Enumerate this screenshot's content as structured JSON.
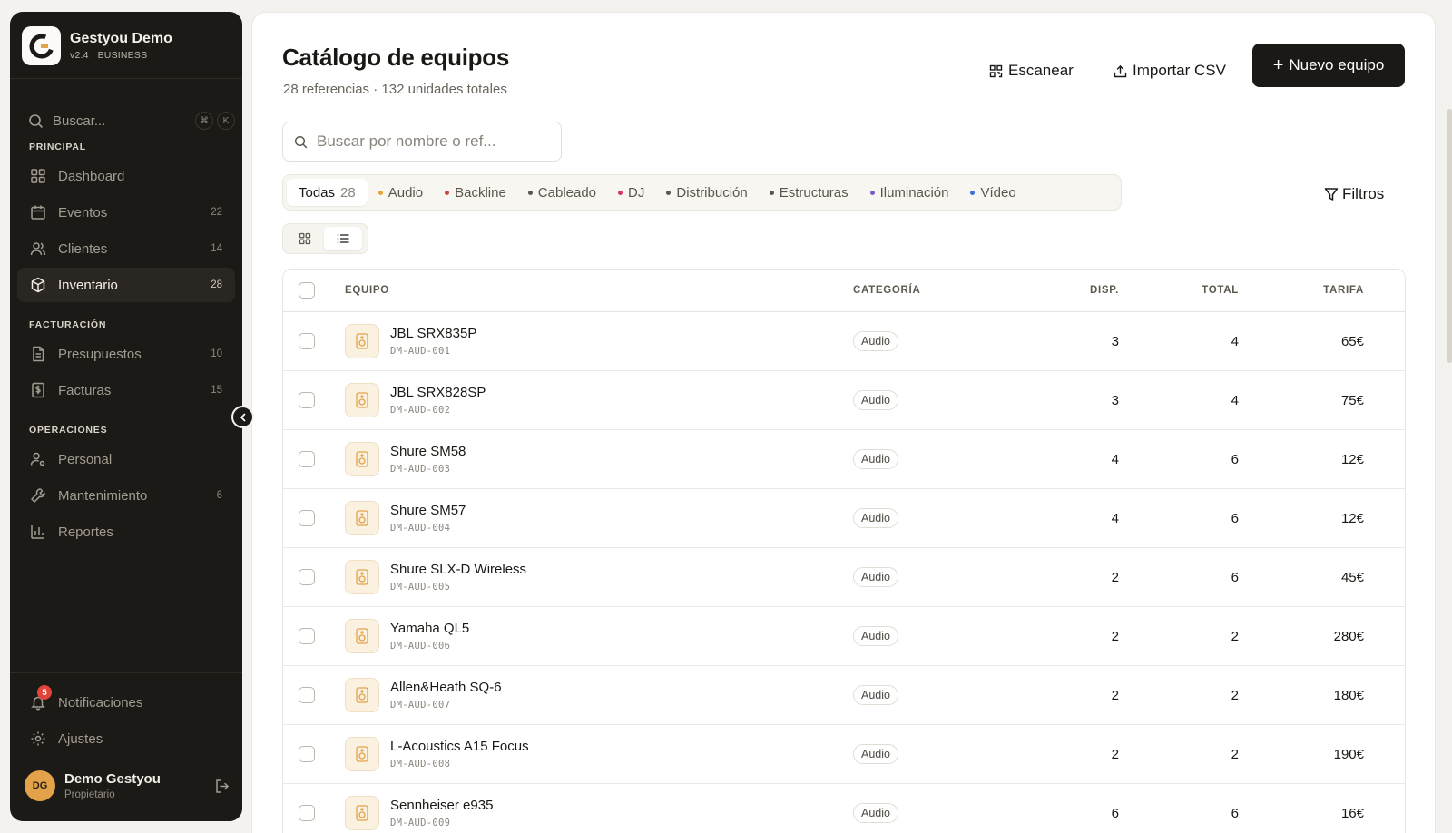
{
  "app": {
    "name": "Gestyou Demo",
    "version": "v2.4 · BUSINESS"
  },
  "sidebar": {
    "search": {
      "label": "Buscar...",
      "kbd1": "⌘",
      "kbd2": "K"
    },
    "sections": {
      "principal": "PRINCIPAL",
      "facturacion": "FACTURACIÓN",
      "operaciones": "OPERACIONES"
    },
    "items": [
      {
        "label": "Dashboard",
        "count": "",
        "icon": "grid-icon"
      },
      {
        "label": "Eventos",
        "count": "22",
        "icon": "calendar-icon"
      },
      {
        "label": "Clientes",
        "count": "14",
        "icon": "users-icon"
      },
      {
        "label": "Inventario",
        "count": "28",
        "icon": "box-icon",
        "active": true
      },
      {
        "label": "Presupuestos",
        "count": "10",
        "icon": "document-icon"
      },
      {
        "label": "Facturas",
        "count": "15",
        "icon": "invoice-icon"
      },
      {
        "label": "Personal",
        "count": "",
        "icon": "user-settings-icon"
      },
      {
        "label": "Mantenimiento",
        "count": "6",
        "icon": "wrench-icon"
      },
      {
        "label": "Reportes",
        "count": "",
        "icon": "bar-chart-icon"
      }
    ],
    "bottom": {
      "notifications": "Notificaciones",
      "notifications_badge": "5",
      "settings": "Ajustes"
    },
    "user": {
      "initials": "DG",
      "name": "Demo Gestyou",
      "role": "Propietario"
    }
  },
  "header": {
    "title": "Catálogo de equipos",
    "subtitle": "28 referencias · 132 unidades totales",
    "scan_label": "Escanear",
    "import_label": "Importar CSV",
    "new_label": "Nuevo equipo"
  },
  "search": {
    "placeholder": "Buscar por nombre o ref..."
  },
  "categories": [
    {
      "label": "Todas",
      "count": "28",
      "active": true
    },
    {
      "label": "Audio",
      "color": "#e8a23a"
    },
    {
      "label": "Backline",
      "color": "#c8493a"
    },
    {
      "label": "Cableado",
      "color": "#5a554d"
    },
    {
      "label": "DJ",
      "color": "#d6336c"
    },
    {
      "label": "Distribución",
      "color": "#5a554d"
    },
    {
      "label": "Estructuras",
      "color": "#5a554d"
    },
    {
      "label": "Iluminación",
      "color": "#7c5cc4"
    },
    {
      "label": "Vídeo",
      "color": "#3a6fd8"
    }
  ],
  "filters_label": "Filtros",
  "view_modes": [
    "grid-view-icon",
    "list-view-icon"
  ],
  "table": {
    "columns": {
      "equipo": "EQUIPO",
      "categoria": "CATEGORÍA",
      "disp": "DISP.",
      "total": "TOTAL",
      "tarifa": "TARIFA"
    },
    "rows": [
      {
        "name": "JBL SRX835P",
        "ref": "DM-AUD-001",
        "category": "Audio",
        "disp": "3",
        "total": "4",
        "rate": "65€"
      },
      {
        "name": "JBL SRX828SP",
        "ref": "DM-AUD-002",
        "category": "Audio",
        "disp": "3",
        "total": "4",
        "rate": "75€"
      },
      {
        "name": "Shure SM58",
        "ref": "DM-AUD-003",
        "category": "Audio",
        "disp": "4",
        "total": "6",
        "rate": "12€"
      },
      {
        "name": "Shure SM57",
        "ref": "DM-AUD-004",
        "category": "Audio",
        "disp": "4",
        "total": "6",
        "rate": "12€"
      },
      {
        "name": "Shure SLX-D Wireless",
        "ref": "DM-AUD-005",
        "category": "Audio",
        "disp": "2",
        "total": "6",
        "rate": "45€"
      },
      {
        "name": "Yamaha QL5",
        "ref": "DM-AUD-006",
        "category": "Audio",
        "disp": "2",
        "total": "2",
        "rate": "280€"
      },
      {
        "name": "Allen&Heath SQ-6",
        "ref": "DM-AUD-007",
        "category": "Audio",
        "disp": "2",
        "total": "2",
        "rate": "180€"
      },
      {
        "name": "L-Acoustics A15 Focus",
        "ref": "DM-AUD-008",
        "category": "Audio",
        "disp": "2",
        "total": "2",
        "rate": "190€"
      },
      {
        "name": "Sennheiser e935",
        "ref": "DM-AUD-009",
        "category": "Audio",
        "disp": "6",
        "total": "6",
        "rate": "16€"
      }
    ]
  },
  "colors": {
    "sidebar_bg": "#1c1a17",
    "primary_button": "#1b1916",
    "accent": "#e3a24a",
    "badge_red": "#e0443a"
  }
}
